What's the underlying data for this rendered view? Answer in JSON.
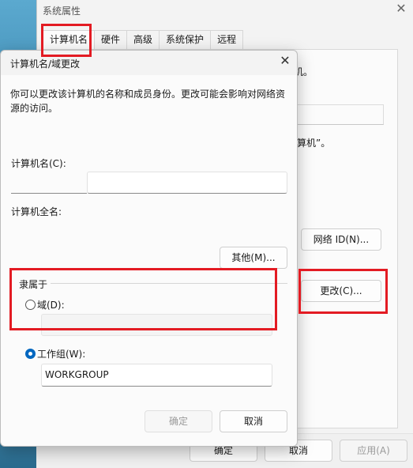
{
  "system_properties": {
    "title": "系统属性",
    "tabs": [
      {
        "label": "计算机名"
      },
      {
        "label": "硬件"
      },
      {
        "label": "高级"
      },
      {
        "label": "系统保护"
      },
      {
        "label": "远程"
      }
    ],
    "partial_text_1": "机。",
    "partial_text_2": "算机”。",
    "network_id_button": "网络 ID(N)...",
    "change_button": "更改(C)...",
    "footer": {
      "ok": "确定",
      "cancel": "取消",
      "apply": "应用(A)"
    }
  },
  "dialog": {
    "title": "计算机名/域更改",
    "description": "你可以更改该计算机的名称和成员身份。更改可能会影响对网络资源的访问。",
    "computer_name_label": "计算机名(C):",
    "computer_name_value": "",
    "full_name_label": "计算机全名:",
    "more_button": "其他(M)...",
    "member_of_label": "隶属于",
    "domain_label": "域(D):",
    "domain_value": "",
    "workgroup_label": "工作组(W):",
    "workgroup_value": "WORKGROUP",
    "ok_button": "确定",
    "cancel_button": "取消"
  },
  "icons": {
    "close": "✕"
  },
  "colors": {
    "highlight": "#e31b23",
    "accent": "#0067c0"
  }
}
